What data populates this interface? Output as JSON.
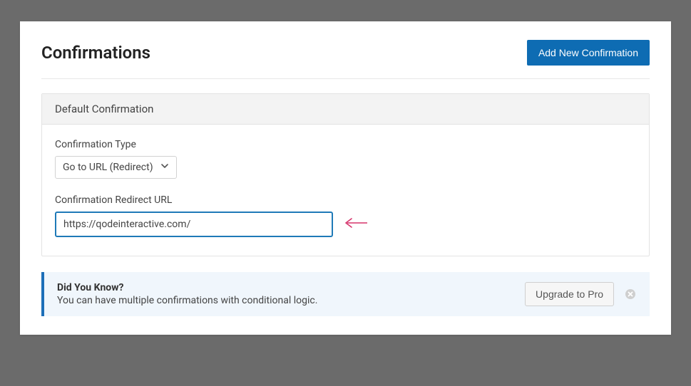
{
  "header": {
    "title": "Confirmations",
    "add_button": "Add New Confirmation"
  },
  "card": {
    "title": "Default Confirmation",
    "type_label": "Confirmation Type",
    "type_value": "Go to URL (Redirect)",
    "url_label": "Confirmation Redirect URL",
    "url_value": "https://qodeinteractive.com/"
  },
  "notice": {
    "title": "Did You Know?",
    "body": "You can have multiple confirmations with conditional logic.",
    "upgrade_button": "Upgrade to Pro"
  }
}
